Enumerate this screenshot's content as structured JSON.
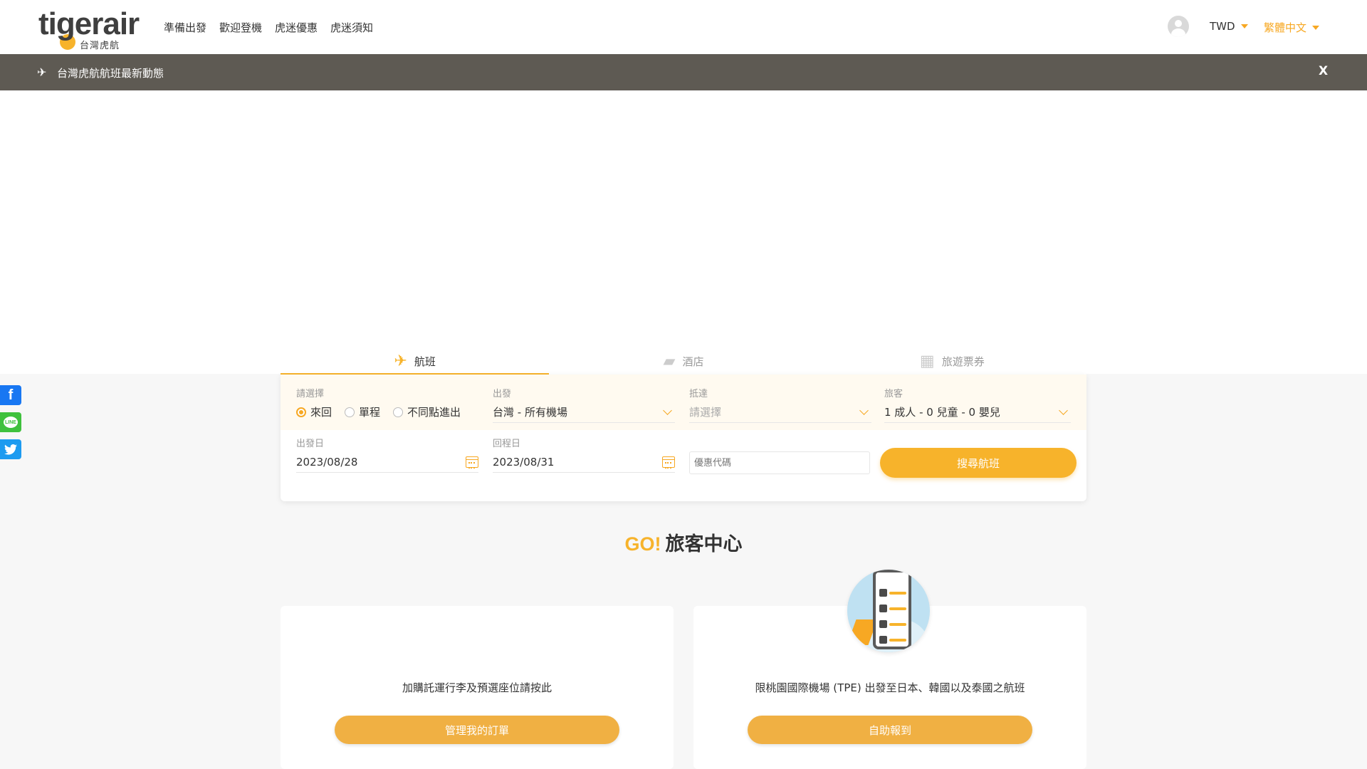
{
  "header": {
    "logo_text": "tigerair",
    "logo_sub": "台灣虎航",
    "nav": [
      "準備出發",
      "歡迎登機",
      "虎迷優惠",
      "虎迷須知"
    ],
    "currency": "TWD",
    "language": "繁體中文"
  },
  "notice": {
    "text": "台灣虎航航班最新動態",
    "close": "X"
  },
  "booking": {
    "tabs": [
      {
        "label": "航班",
        "icon": "airplane-icon"
      },
      {
        "label": "酒店",
        "icon": "bed-icon"
      },
      {
        "label": "旅遊票券",
        "icon": "ticket-icon"
      }
    ],
    "trip_type_label": "請選擇",
    "trip_types": [
      "來回",
      "單程",
      "不同點進出"
    ],
    "origin_label": "出發",
    "origin_value": "台灣 - 所有機場",
    "destination_label": "抵達",
    "destination_value": "請選擇",
    "passengers_label": "旅客",
    "passengers_value": "1 成人 - 0 兒童 - 0 嬰兒",
    "depart_label": "出發日",
    "depart_value": "2023/08/28",
    "return_label": "回程日",
    "return_value": "2023/08/31",
    "promo_placeholder": "優惠代碼",
    "search_button": "搜尋航班"
  },
  "go_section": {
    "title_go": "GO!",
    "title_text": "旅客中心",
    "cards": [
      {
        "text": "加購託運行李及預選座位請按此",
        "button": "管理我的訂單"
      },
      {
        "text": "限桃園國際機場 (TPE) 出發至日本、韓國以及泰國之航班",
        "button": "自助報到"
      }
    ]
  },
  "social": [
    "f",
    "LINE",
    "twitter"
  ]
}
